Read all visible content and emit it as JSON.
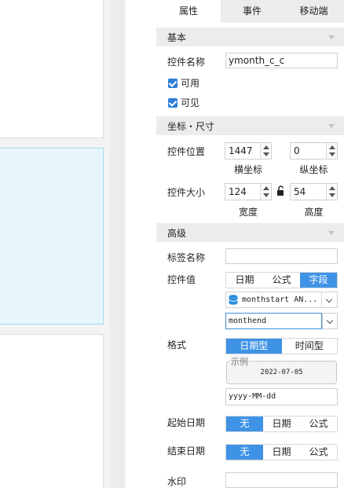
{
  "tabs": [
    "属性",
    "事件",
    "移动端"
  ],
  "sections": {
    "basic": "基本",
    "position": "坐标・尺寸",
    "advanced": "高级"
  },
  "basic": {
    "name_label": "控件名称",
    "name_value": "ymonth_c_c",
    "enabled_label": "可用",
    "visible_label": "可见"
  },
  "position": {
    "pos_label": "控件位置",
    "x_value": "1447",
    "y_value": "0",
    "x_caption": "横坐标",
    "y_caption": "纵坐标",
    "size_label": "控件大小",
    "width_value": "124",
    "height_value": "54",
    "width_caption": "宽度",
    "height_caption": "高度"
  },
  "advanced": {
    "tag_label": "标签名称",
    "tag_value": "",
    "value_label": "控件值",
    "value_options": [
      "日期",
      "公式",
      "字段"
    ],
    "value_selected": 2,
    "field_select": "monthstart  AN...",
    "field_input": "monthend",
    "format_label": "格式",
    "format_options": [
      "日期型",
      "时间型"
    ],
    "format_selected": 0,
    "example_legend": "示例",
    "example_value": "2022-07-05",
    "format_pattern": "yyyy-MM-dd",
    "start_label": "起始日期",
    "end_label": "结束日期",
    "date_mode_options": [
      "无",
      "日期",
      "公式"
    ],
    "start_selected": 0,
    "end_selected": 0,
    "watermark_label": "水印",
    "watermark_value": ""
  },
  "colors": {
    "accent": "#3f93e6",
    "section_bg": "#ececec",
    "selected_widget_bg": "#e6f6fc"
  }
}
